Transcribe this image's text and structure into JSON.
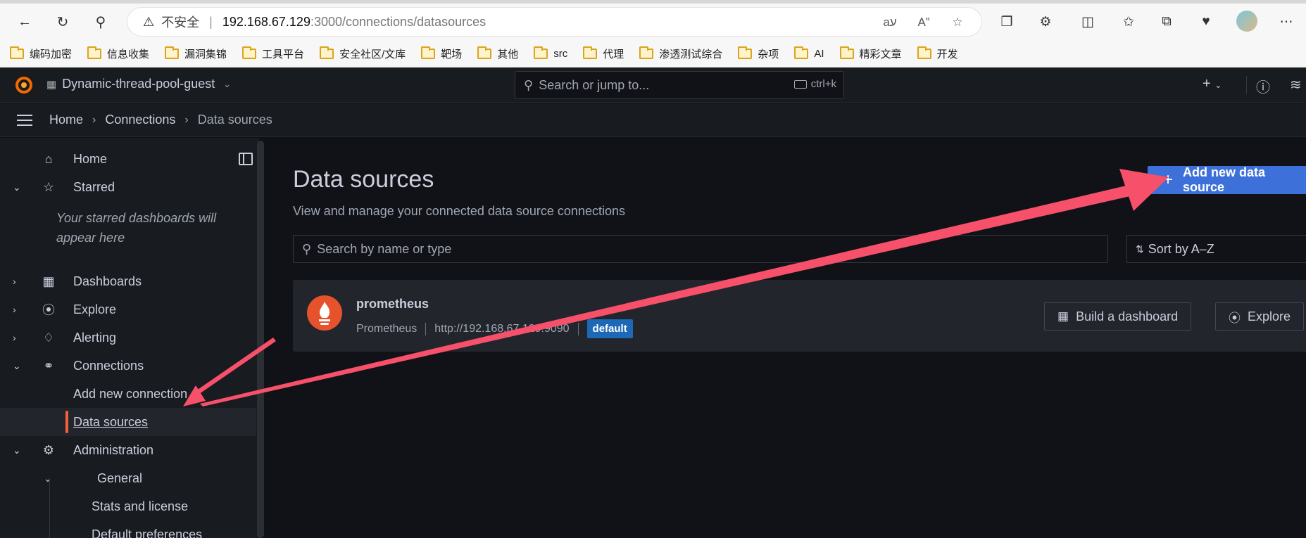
{
  "browser": {
    "insecure_label": "不安全",
    "url_host": "192.168.67.129",
    "url_rest": ":3000/connections/datasources",
    "bookmarks": [
      "编码加密",
      "信息收集",
      "漏洞集锦",
      "工具平台",
      "安全社区/文库",
      "靶场",
      "其他",
      "src",
      "代理",
      "渗透测试综合",
      "杂项",
      "AI",
      "精彩文章",
      "开发"
    ]
  },
  "topbar": {
    "org_name": "Dynamic-thread-pool-guest",
    "search_placeholder": "Search or jump to...",
    "shortcut": "ctrl+k"
  },
  "breadcrumb": {
    "home": "Home",
    "connections": "Connections",
    "current": "Data sources"
  },
  "sidebar": {
    "home": "Home",
    "starred": "Starred",
    "starred_empty": "Your starred dashboards will appear here",
    "dashboards": "Dashboards",
    "explore": "Explore",
    "alerting": "Alerting",
    "connections": "Connections",
    "add_new_connection": "Add new connection",
    "data_sources": "Data sources",
    "administration": "Administration",
    "general": "General",
    "stats_and_license": "Stats and license",
    "default_preferences": "Default preferences"
  },
  "main": {
    "title": "Data sources",
    "subtitle": "View and manage your connected data source connections",
    "add_button": "Add new data source",
    "search_placeholder": "Search by name or type",
    "sort_label": "Sort by A–Z",
    "datasource": {
      "name": "prometheus",
      "type": "Prometheus",
      "url": "http://192.168.67.129:9090",
      "badge": "default",
      "build_dashboard": "Build a dashboard",
      "explore": "Explore"
    }
  },
  "colors": {
    "accent_primary": "#3d71d9",
    "active_indicator": "#f55f3e",
    "annotation_arrow": "#f7506a"
  }
}
